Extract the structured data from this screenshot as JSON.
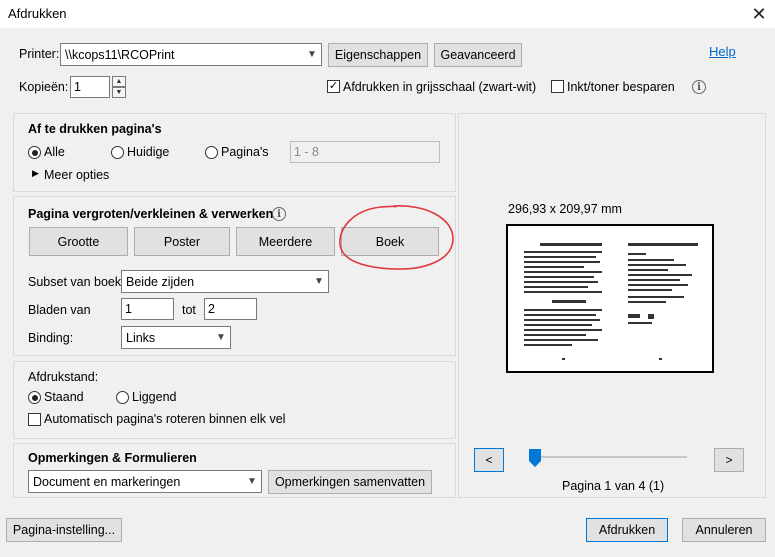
{
  "window": {
    "title": "Afdrukken",
    "close_glyph": "✕"
  },
  "printer": {
    "label": "Printer:",
    "value": "\\\\kcops11\\RCOPrint",
    "properties_btn": "Eigenschappen",
    "advanced_btn": "Geavanceerd",
    "help_link": "Help"
  },
  "copies": {
    "label": "Kopieën:",
    "value": "1"
  },
  "grayscale": {
    "label": "Afdrukken in grijsschaal (zwart-wit)",
    "checked": true
  },
  "save_ink": {
    "label": "Inkt/toner besparen",
    "checked": false
  },
  "pages": {
    "heading": "Af te drukken pagina's",
    "all": "Alle",
    "current": "Huidige",
    "pages": "Pagina's",
    "range_value": "1 - 8",
    "more_options": "Meer opties"
  },
  "sizing": {
    "heading": "Pagina vergroten/verkleinen & verwerken",
    "size_btn": "Grootte",
    "poster_btn": "Poster",
    "multiple_btn": "Meerdere",
    "booklet_btn": "Boek",
    "subset_label": "Subset van boek:",
    "subset_value": "Beide zijden",
    "sheets_label": "Bladen van",
    "sheets_from": "1",
    "sheets_to_label": "tot",
    "sheets_to": "2",
    "binding_label": "Binding:",
    "binding_value": "Links"
  },
  "orientation": {
    "heading": "Afdrukstand:",
    "portrait": "Staand",
    "landscape": "Liggend",
    "auto_rotate": "Automatisch pagina's roteren binnen elk vel"
  },
  "comments": {
    "heading": "Opmerkingen & Formulieren",
    "select_value": "Document en markeringen",
    "summarize_btn": "Opmerkingen samenvatten"
  },
  "preview": {
    "dimensions": "296,93 x 209,97 mm",
    "prev": "<",
    "next": ">",
    "page_status": "Pagina 1 van 4 (1)",
    "slider_fraction": 0.0
  },
  "footer": {
    "page_setup_btn": "Pagina-instelling...",
    "print_btn": "Afdrukken",
    "cancel_btn": "Annuleren"
  },
  "colors": {
    "annotation_circle": "#e0393e",
    "link": "#0066cc",
    "focus": "#0078d7"
  }
}
